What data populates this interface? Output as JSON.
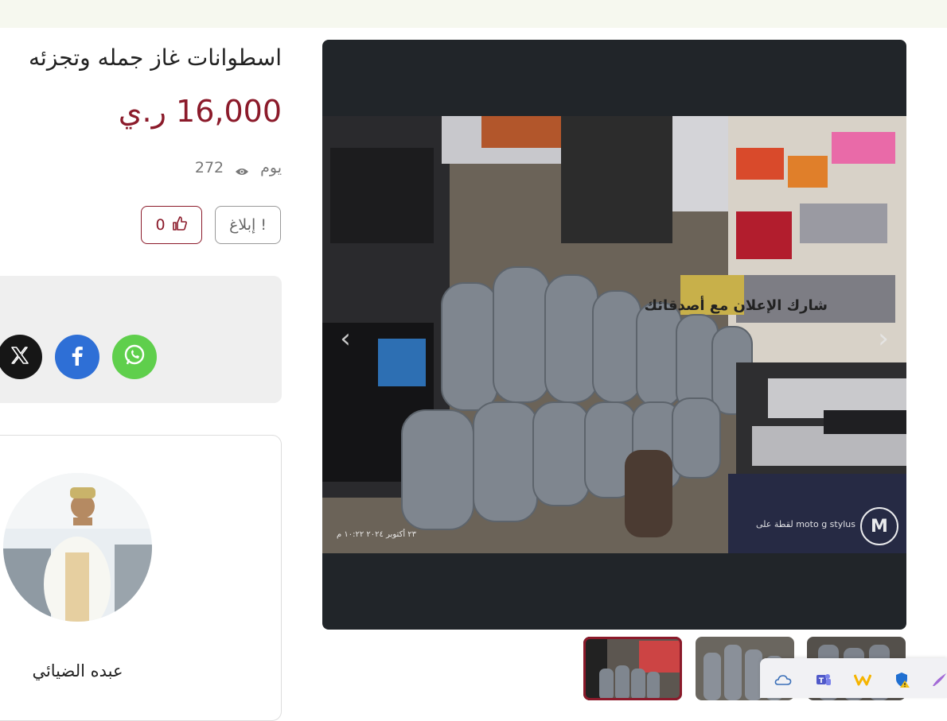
{
  "listing": {
    "title": "اسطوانات غاز جمله وتجزئه",
    "price": "16,000 ر.ي",
    "time_label": "يوم",
    "views": "272",
    "report_label": "إبلاغ",
    "likes": "0"
  },
  "share": {
    "title": "شارك الإعلان مع أصدقائك",
    "buttons": [
      "whatsapp-icon",
      "facebook-icon",
      "x-icon"
    ]
  },
  "seller": {
    "name": "عبده الضيائي"
  },
  "gallery": {
    "photo_stamp": "٢٣ أكتوبر ٢٠٢٤ ١٠:٢٢ م",
    "photo_watermark": "لقطة على moto g stylus",
    "thumbnail_count": 3,
    "active_thumbnail": 1
  },
  "tray": {
    "icons": [
      "onedrive-cloud-icon",
      "teams-icon",
      "wps-icon",
      "defender-shield-icon",
      "pen-icon"
    ]
  },
  "colors": {
    "accent": "#8b1a2a",
    "viewer_bg": "#212529",
    "whatsapp": "#5fcf4c",
    "facebook": "#2e6fd6"
  }
}
